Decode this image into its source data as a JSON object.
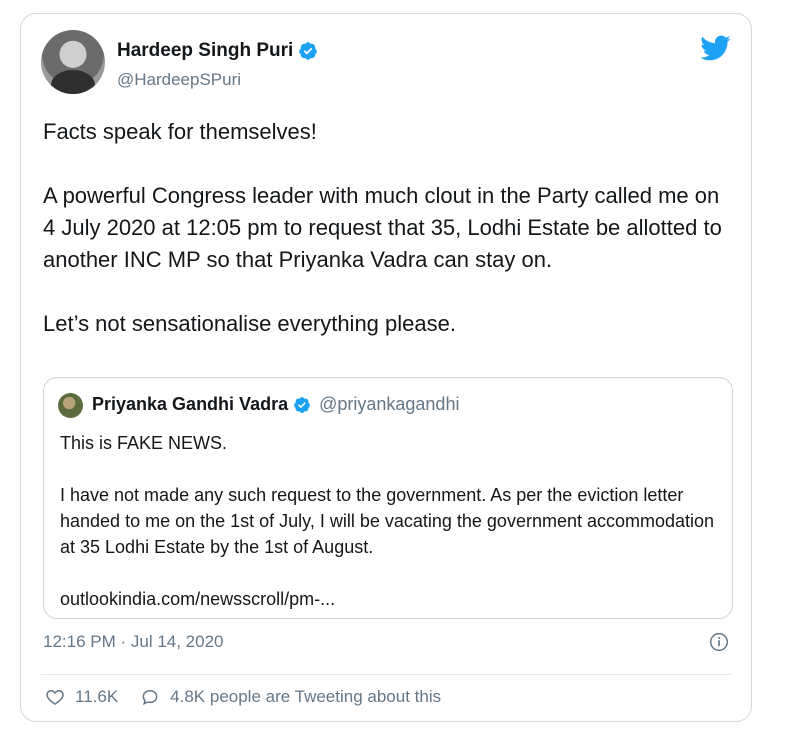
{
  "author": {
    "name": "Hardeep Singh Puri",
    "handle": "@HardeepSPuri"
  },
  "tweet": {
    "lines": [
      "Facts speak for themselves!",
      "A powerful Congress leader with much clout in the Party called me on 4 July 2020 at 12:05 pm to request that 35, Lodhi Estate be allotted to another INC MP so that Priyanka Vadra can stay on.",
      "Let’s not sensationalise everything please."
    ]
  },
  "quoted_tweet": {
    "name": "Priyanka Gandhi Vadra",
    "handle": "@priyankagandhi",
    "lines": [
      "This is FAKE NEWS.",
      "I have not made any such request to the government. As per the eviction letter handed to me on the 1st of July, I will be vacating the government accommodation at 35 Lodhi Estate by the 1st of August.",
      "outlookindia.com/newsscroll/pm-..."
    ]
  },
  "meta": {
    "timestamp": "12:16 PM · Jul 14, 2020"
  },
  "actions": {
    "likes": "11.6K",
    "tweeting": "4.8K people are Tweeting about this"
  },
  "icons": {
    "verified": "verified-badge-icon",
    "brand": "twitter-bird-icon",
    "info": "info-icon",
    "like": "heart-icon",
    "reply": "speech-bubble-icon"
  },
  "colors": {
    "brand": "#1da1f2",
    "text": "#14171a",
    "secondary": "#657786",
    "border": "#d6d9db"
  }
}
